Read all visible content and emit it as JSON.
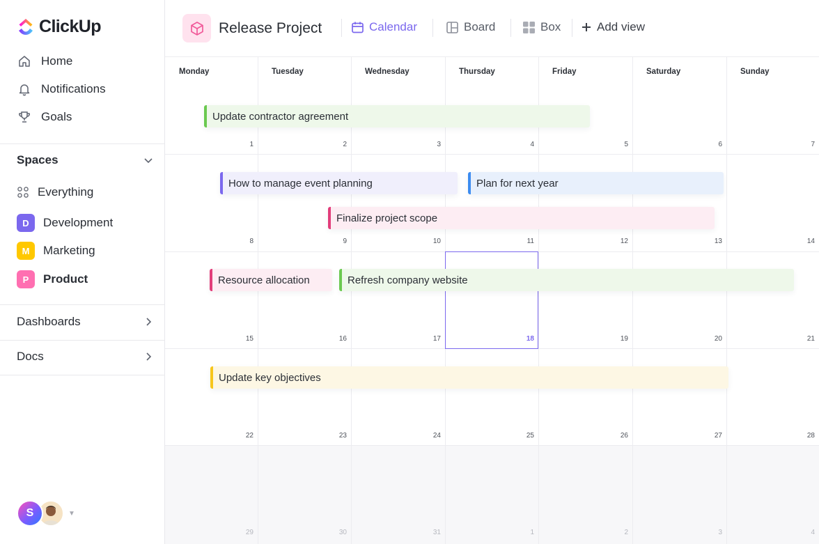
{
  "brand": {
    "name": "ClickUp"
  },
  "nav": [
    {
      "label": "Home",
      "icon": "home-icon"
    },
    {
      "label": "Notifications",
      "icon": "bell-icon"
    },
    {
      "label": "Goals",
      "icon": "trophy-icon"
    }
  ],
  "spaces": {
    "title": "Spaces",
    "items": [
      {
        "label": "Everything",
        "icon": "grid-dots-icon"
      },
      {
        "label": "Development",
        "letter": "D",
        "color": "#7b68ee"
      },
      {
        "label": "Marketing",
        "letter": "M",
        "color": "#ffc800"
      },
      {
        "label": "Product",
        "letter": "P",
        "color": "#ff6fb1",
        "active": true
      }
    ]
  },
  "sections": [
    {
      "label": "Dashboards"
    },
    {
      "label": "Docs"
    }
  ],
  "users": {
    "first_initial": "S"
  },
  "header": {
    "project_title": "Release Project",
    "views": [
      {
        "label": "Calendar",
        "icon": "calendar-icon",
        "active": true
      },
      {
        "label": "Board",
        "icon": "board-icon"
      },
      {
        "label": "Box",
        "icon": "box-grid-icon"
      },
      {
        "label": "Add view",
        "icon": "plus-icon"
      }
    ]
  },
  "calendar": {
    "days": [
      "Monday",
      "Tuesday",
      "Wednesday",
      "Thursday",
      "Friday",
      "Saturday",
      "Sunday"
    ],
    "weeks": [
      [
        "1",
        "2",
        "3",
        "4",
        "5",
        "6",
        "7"
      ],
      [
        "8",
        "9",
        "10",
        "11",
        "12",
        "13",
        "14"
      ],
      [
        "15",
        "16",
        "17",
        "18",
        "19",
        "20",
        "21"
      ],
      [
        "22",
        "23",
        "24",
        "25",
        "26",
        "27",
        "28"
      ],
      [
        "29",
        "30",
        "31",
        "1",
        "2",
        "3",
        "4"
      ]
    ],
    "today": "18",
    "events": [
      {
        "title": "Update contractor agreement",
        "color": "#6bc950",
        "bg": "#eef8ea"
      },
      {
        "title": "How to manage event planning",
        "color": "#7b68ee",
        "bg": "#f0effc"
      },
      {
        "title": "Plan for next year",
        "color": "#3d8cf0",
        "bg": "#e8f0fc"
      },
      {
        "title": "Finalize project scope",
        "color": "#e23d7a",
        "bg": "#fdedf3"
      },
      {
        "title": "Resource allocation",
        "color": "#e23d7a",
        "bg": "#fdedf3"
      },
      {
        "title": "Refresh company website",
        "color": "#6bc950",
        "bg": "#eef8ea"
      },
      {
        "title": "Update key objectives",
        "color": "#f7c61c",
        "bg": "#fdf7e4"
      }
    ]
  }
}
